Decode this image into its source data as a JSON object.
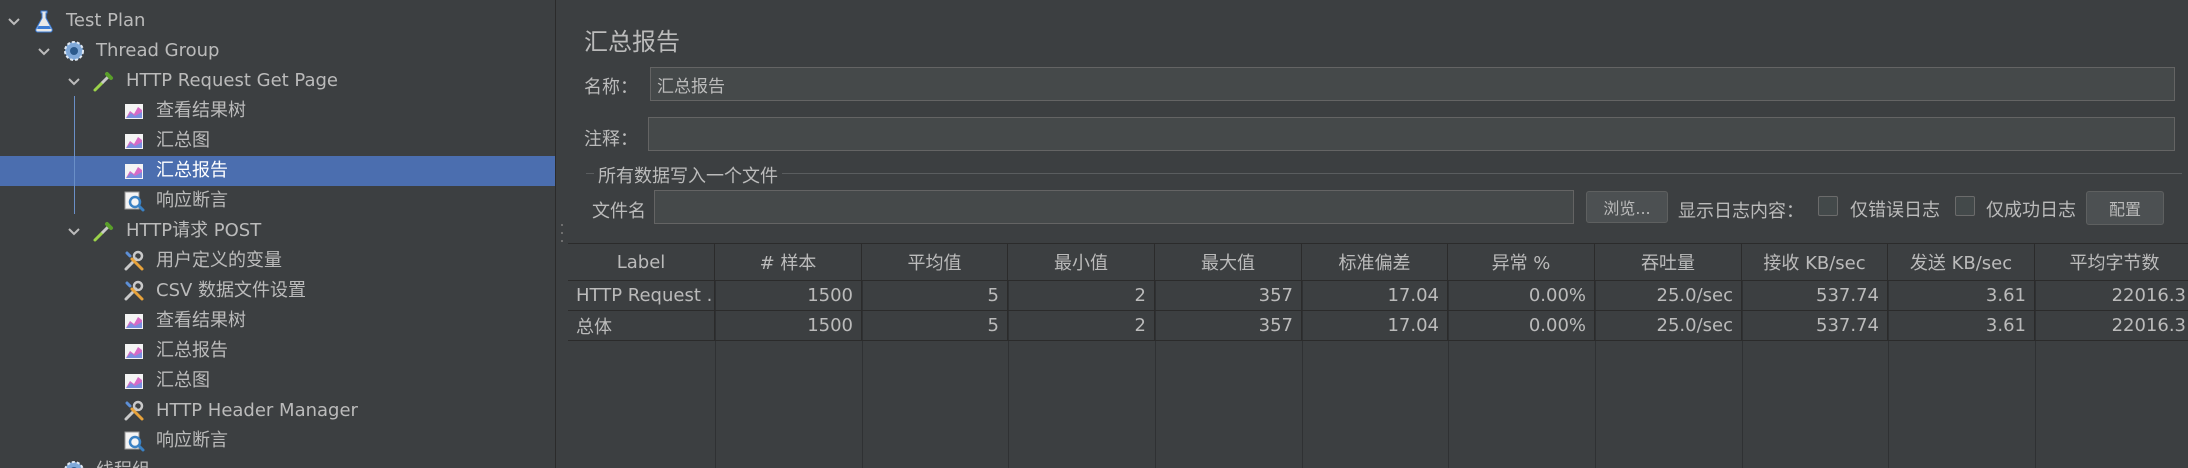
{
  "tree": {
    "items": [
      {
        "label": "Test Plan",
        "icon": "flask-icon",
        "name": "tree-item-test-plan"
      },
      {
        "label": "Thread Group",
        "icon": "gear-icon",
        "name": "tree-item-thread-group"
      },
      {
        "label": "HTTP Request Get Page",
        "icon": "pipette-icon",
        "name": "tree-item-http-request-get-page"
      },
      {
        "label": "查看结果树",
        "icon": "listener-chart-icon",
        "name": "tree-item-view-results-tree-1"
      },
      {
        "label": "汇总图",
        "icon": "listener-chart-icon",
        "name": "tree-item-aggregate-graph-1"
      },
      {
        "label": "汇总报告",
        "icon": "listener-chart-icon",
        "name": "tree-item-summary-report-1"
      },
      {
        "label": "响应断言",
        "icon": "magnifier-icon",
        "name": "tree-item-response-assertion-1"
      },
      {
        "label": "HTTP请求 POST",
        "icon": "pipette-icon",
        "name": "tree-item-http-request-post"
      },
      {
        "label": "用户定义的变量",
        "icon": "wrench-icon",
        "name": "tree-item-user-defined-variables"
      },
      {
        "label": "CSV 数据文件设置",
        "icon": "wrench-icon",
        "name": "tree-item-csv-data-set"
      },
      {
        "label": "查看结果树",
        "icon": "listener-chart-icon",
        "name": "tree-item-view-results-tree-2"
      },
      {
        "label": "汇总报告",
        "icon": "listener-chart-icon",
        "name": "tree-item-summary-report-2"
      },
      {
        "label": "汇总图",
        "icon": "listener-chart-icon",
        "name": "tree-item-aggregate-graph-2"
      },
      {
        "label": "HTTP Header Manager",
        "icon": "wrench-icon",
        "name": "tree-item-http-header-manager"
      },
      {
        "label": "响应断言",
        "icon": "magnifier-icon",
        "name": "tree-item-response-assertion-2"
      },
      {
        "label": "线程组",
        "icon": "gear-icon",
        "name": "tree-item-thread-group-2"
      }
    ],
    "selected_index": 5
  },
  "panel": {
    "title": "汇总报告",
    "name_label": "名称：",
    "name_value": "汇总报告",
    "comment_label": "注释：",
    "comment_value": "",
    "file_group_title": "所有数据写入一个文件",
    "filename_label": "文件名",
    "filename_value": "",
    "browse_button": "浏览...",
    "log_content_label": "显示日志内容：",
    "errors_only_label": "仅错误日志",
    "success_only_label": "仅成功日志",
    "configure_button": "配置"
  },
  "table": {
    "columns": [
      "Label",
      "# 样本",
      "平均值",
      "最小值",
      "最大值",
      "标准偏差",
      "异常 %",
      "吞吐量",
      "接收 KB/sec",
      "发送 KB/sec",
      "平均字节数"
    ],
    "rows": [
      [
        "HTTP Request ...",
        "1500",
        "5",
        "2",
        "357",
        "17.04",
        "0.00%",
        "25.0/sec",
        "537.74",
        "3.61",
        "22016.3"
      ],
      [
        "总体",
        "1500",
        "5",
        "2",
        "357",
        "17.04",
        "0.00%",
        "25.0/sec",
        "537.74",
        "3.61",
        "22016.3"
      ]
    ]
  },
  "colors": {
    "background": "#3c3f41",
    "selection": "#4b6eaf",
    "text": "#bbbbbb"
  }
}
